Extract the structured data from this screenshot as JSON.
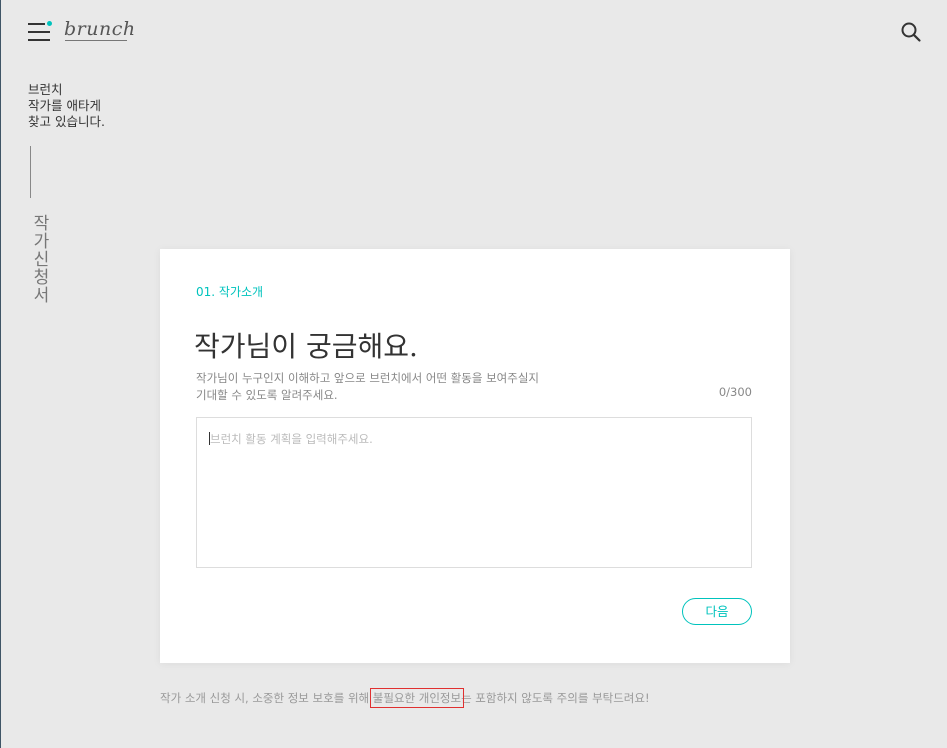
{
  "header": {
    "menu_icon": "hamburger-menu-icon",
    "logo": "brunch",
    "search_icon": "search-icon"
  },
  "side": {
    "tagline_lines": [
      "브런치",
      "작가를 애타게",
      "찾고 있습니다."
    ],
    "vertical_title": "작가신청서"
  },
  "form": {
    "step": "01. 작가소개",
    "title": "작가님이 궁금해요.",
    "description_lines": [
      "작가님이 누구인지 이해하고 앞으로 브런치에서 어떤 활동을 보여주실지",
      "기대할 수 있도록 알려주세요."
    ],
    "counter": "0/300",
    "textarea": {
      "value": "",
      "placeholder": "브런치 활동 계획을 입력해주세요."
    },
    "next_label": "다음"
  },
  "notice": {
    "before": "작가 소개 신청 시, 소중한 정보 보호를 위해 ",
    "highlight": "불필요한 개인정보",
    "after": "는 포함하지 않도록 주의를 부탁드려요!"
  },
  "colors": {
    "accent": "#00c3bd",
    "background": "#e9e9e9",
    "card": "#ffffff",
    "highlight_box": "#e03030"
  }
}
